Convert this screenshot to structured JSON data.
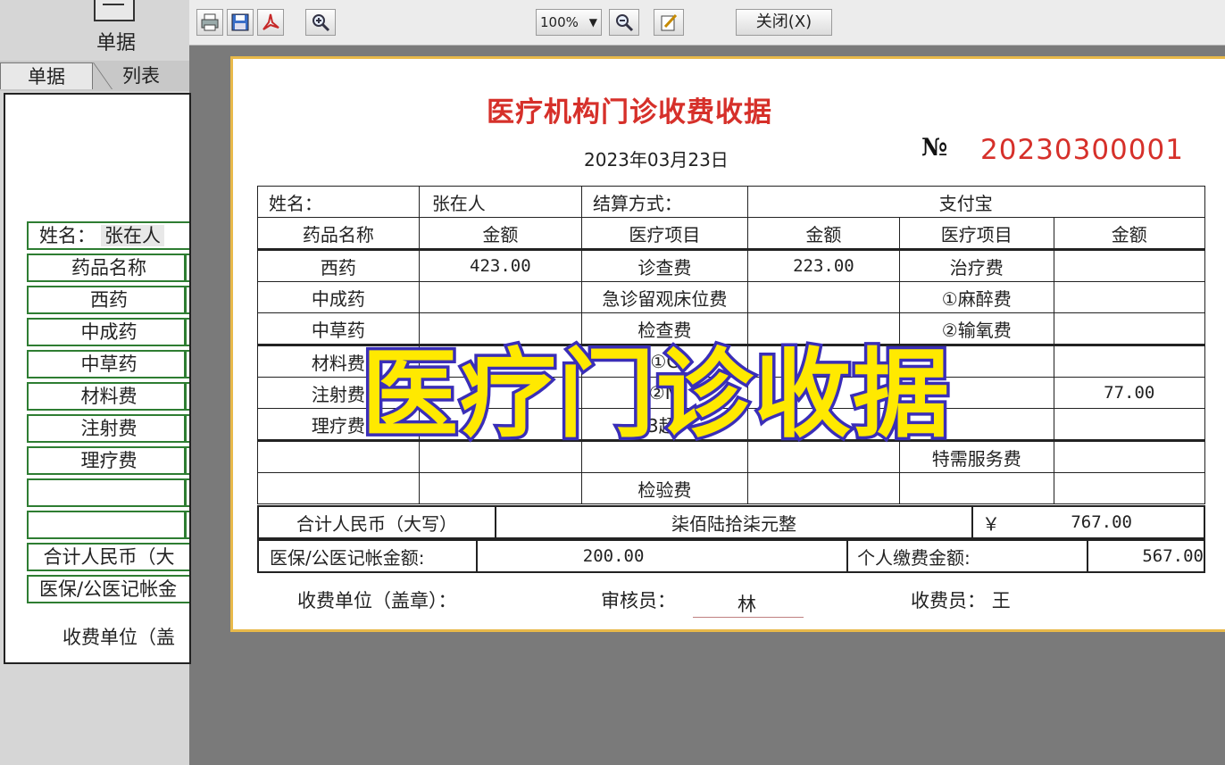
{
  "left_panel": {
    "nav_label": "单据",
    "tabs": [
      "单据",
      "列表"
    ],
    "name_label": "姓名：",
    "name_value": "张在人",
    "rows": [
      "药品名称",
      "西药",
      "中成药",
      "中草药",
      "材料费",
      "注射费",
      "理疗费",
      "",
      ""
    ],
    "total_label": "合计人民币（大",
    "insurance_label": "医保/公医记帐金",
    "fee_unit": "收费单位（盖"
  },
  "toolbar": {
    "zoom": "100%",
    "close_label": "关闭(X)"
  },
  "receipt": {
    "title": "医疗机构门诊收费收据",
    "date": "2023年03月23日",
    "no_label": "№",
    "no_value": "20230300001",
    "name_label": "姓名：",
    "name_value": "张在人",
    "payment_label": "结算方式：",
    "payment_value": "支付宝",
    "headers": [
      "药品名称",
      "金额",
      "医疗项目",
      "金额",
      "医疗项目",
      "金额"
    ],
    "rows": [
      [
        "西药",
        "423.00",
        "诊查费",
        "223.00",
        "治疗费",
        ""
      ],
      [
        "中成药",
        "",
        "急诊留观床位费",
        "",
        "①麻醉费",
        ""
      ],
      [
        "中草药",
        "",
        "检查费",
        "",
        "②输氧费",
        ""
      ],
      [
        "材料费",
        "",
        "①C",
        "",
        "",
        ""
      ],
      [
        "注射费",
        "",
        "②M",
        "",
        "",
        "77.00"
      ],
      [
        "理疗费",
        "",
        "3超,",
        "",
        "",
        ""
      ],
      [
        "",
        "",
        "",
        "",
        "特需服务费",
        ""
      ],
      [
        "",
        "",
        "检验费",
        "",
        "",
        ""
      ]
    ],
    "total_label": "合计人民币（大写）",
    "total_words": "柒佰陆拾柒元整",
    "currency": "￥",
    "total_amount": "767.00",
    "insurance_label": "医保/公医记帐金额:",
    "insurance_amount": "200.00",
    "personal_label": "个人缴费金额:",
    "personal_amount": "567.00",
    "fee_unit": "收费单位（盖章）：",
    "reviewer_label": "审核员：",
    "reviewer_value": "林",
    "cashier_label": "收费员：",
    "cashier_value": "王"
  },
  "overlay_caption": "医疗门诊收据"
}
